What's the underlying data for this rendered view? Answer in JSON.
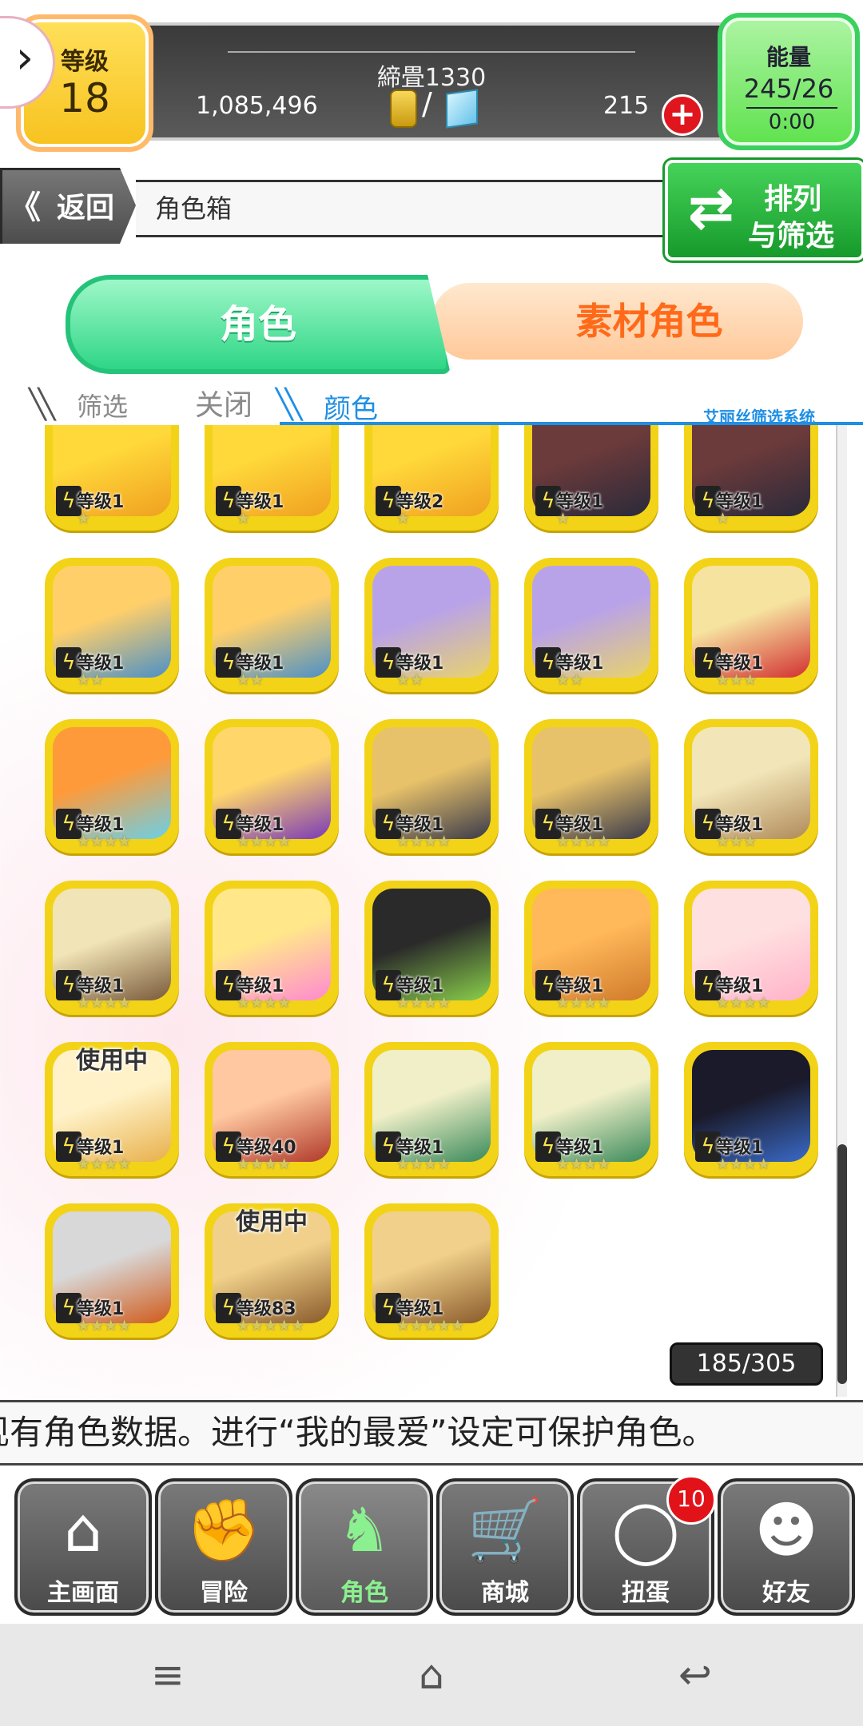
{
  "top_bar": {
    "level_label": "等级",
    "level_value": "18",
    "total_label": "締畳1330",
    "coins": "1,085,496",
    "separator": "/",
    "gems": "215",
    "add_label": "+",
    "energy_label": "能量",
    "energy_value": "245/26",
    "energy_timer": "0:00"
  },
  "nav": {
    "back_label": "返回",
    "back_arrows": "《",
    "title": "角色箱",
    "sort_line1": "排列",
    "sort_line2": "与筛选"
  },
  "tabs": {
    "characters": "角色",
    "materials": "素材角色"
  },
  "filter": {
    "label": "筛选",
    "off_label": "关闭",
    "color_label": "颜色",
    "system_label": "艾丽丝筛选系统"
  },
  "characters": [
    {
      "level": "等级1",
      "stars": "★",
      "art": [
        "#ffd83a",
        "#f0a020"
      ]
    },
    {
      "level": "等级1",
      "stars": "★",
      "art": [
        "#ffd83a",
        "#f0a020"
      ]
    },
    {
      "level": "等级2",
      "stars": "★",
      "art": [
        "#ffd83a",
        "#f0a020"
      ]
    },
    {
      "level": "等级1",
      "stars": "★",
      "art": [
        "#6b3a3a",
        "#2a2a3a"
      ]
    },
    {
      "level": "等级1",
      "stars": "★",
      "art": [
        "#6b3a3a",
        "#2a2a3a"
      ]
    },
    {
      "level": "等级1",
      "stars": "★★",
      "art": [
        "#ffcf6a",
        "#4a90c8"
      ]
    },
    {
      "level": "等级1",
      "stars": "★★",
      "art": [
        "#ffcf6a",
        "#4a90c8"
      ]
    },
    {
      "level": "等级1",
      "stars": "★★",
      "art": [
        "#b9a3e8",
        "#e9d36a"
      ]
    },
    {
      "level": "等级1",
      "stars": "★★",
      "art": [
        "#b9a3e8",
        "#e9d36a"
      ]
    },
    {
      "level": "等级1",
      "stars": "★★★",
      "art": [
        "#f6e3a0",
        "#d23030"
      ]
    },
    {
      "level": "等级1",
      "stars": "★★★★",
      "art": [
        "#ff9a3a",
        "#6ad0e8"
      ]
    },
    {
      "level": "等级1",
      "stars": "★★★★",
      "art": [
        "#ffd66a",
        "#7a3ab8"
      ]
    },
    {
      "level": "等级1",
      "stars": "★★★★",
      "art": [
        "#e8c26a",
        "#3a3a4a"
      ]
    },
    {
      "level": "等级1",
      "stars": "★★★★",
      "art": [
        "#e8c26a",
        "#3a3a4a"
      ]
    },
    {
      "level": "等级1",
      "stars": "★★★",
      "art": [
        "#f2e6b8",
        "#b08a5a"
      ]
    },
    {
      "level": "等级1",
      "stars": "★★★★",
      "art": [
        "#f1e4b6",
        "#7a5a3a"
      ]
    },
    {
      "level": "等级1",
      "stars": "★★★★",
      "art": [
        "#ffe78a",
        "#ff8ad0"
      ]
    },
    {
      "level": "等级1",
      "stars": "★★★★",
      "art": [
        "#2a2a2a",
        "#8ad04a"
      ]
    },
    {
      "level": "等级1",
      "stars": "★★★★",
      "art": [
        "#ffb85a",
        "#d07a2a"
      ]
    },
    {
      "level": "等级1",
      "stars": "★★★★",
      "art": [
        "#ffe0e0",
        "#ffb2c8"
      ]
    },
    {
      "level": "等级1",
      "stars": "★★★★",
      "art": [
        "#fff2c8",
        "#e8b04a"
      ],
      "in_use": "使用中"
    },
    {
      "level": "等级40",
      "stars": "★★★★",
      "art": [
        "#ffc8a0",
        "#b03a2a"
      ]
    },
    {
      "level": "等级1",
      "stars": "★★★★",
      "art": [
        "#f0efc8",
        "#3a8a5a"
      ]
    },
    {
      "level": "等级1",
      "stars": "★★★★",
      "art": [
        "#f0efc8",
        "#3a8a5a"
      ]
    },
    {
      "level": "等级1",
      "stars": "★★★★",
      "art": [
        "#1a1a2a",
        "#3a6ac8"
      ]
    },
    {
      "level": "等级1",
      "stars": "★★★★",
      "art": [
        "#d8d8d8",
        "#d05a1a"
      ]
    },
    {
      "level": "等级83",
      "stars": "★★★★★",
      "art": [
        "#f0d08a",
        "#8a5a2a"
      ],
      "in_use": "使用中"
    },
    {
      "level": "等级1",
      "stars": "★★★★★",
      "art": [
        "#f0d08a",
        "#8a5a2a"
      ]
    }
  ],
  "counter": "185/305",
  "ticker": "现有角色数据。进行“我的最爱”设定可保护角色。",
  "bottom_nav": [
    {
      "label": "主画面",
      "icon": "⌂",
      "icon_name": "home-icon"
    },
    {
      "label": "冒险",
      "icon": "✊",
      "icon_name": "handshake-icon"
    },
    {
      "label": "角色",
      "icon": "♞",
      "icon_name": "bunny-icon"
    },
    {
      "label": "商城",
      "icon": "🛒",
      "icon_name": "cart-icon"
    },
    {
      "label": "扭蛋",
      "icon": "◯",
      "icon_name": "egg-icon"
    },
    {
      "label": "好友",
      "icon": "☻",
      "icon_name": "friends-icon"
    }
  ],
  "gacha_badge": "10",
  "system_bar": {
    "menu": "≡",
    "home": "⌂",
    "back": "↩"
  }
}
